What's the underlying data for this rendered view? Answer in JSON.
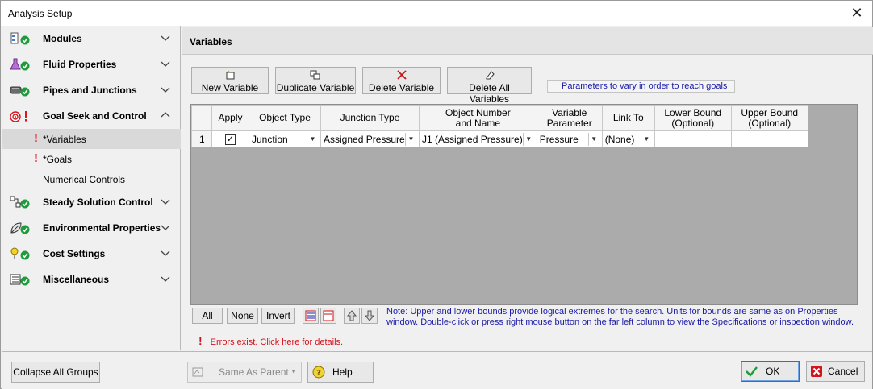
{
  "window": {
    "title": "Analysis Setup"
  },
  "nav": {
    "groups": [
      {
        "label": "Modules",
        "icon": "modules-icon"
      },
      {
        "label": "Fluid Properties",
        "icon": "flask-icon"
      },
      {
        "label": "Pipes and Junctions",
        "icon": "pipe-icon"
      },
      {
        "label": "Goal Seek and Control",
        "icon": "target-icon"
      },
      {
        "label": "Steady Solution Control",
        "icon": "solution-icon"
      },
      {
        "label": "Environmental Properties",
        "icon": "leaf-icon"
      },
      {
        "label": "Cost Settings",
        "icon": "coin-icon"
      },
      {
        "label": "Miscellaneous",
        "icon": "list-icon"
      }
    ],
    "subitems": [
      {
        "label": "*Variables",
        "error": "!"
      },
      {
        "label": "*Goals",
        "error": "!"
      },
      {
        "label": "Numerical Controls",
        "error": ""
      }
    ]
  },
  "panel": {
    "title": "Variables",
    "toolbar": {
      "new_variable": "New Variable",
      "duplicate_variable": "Duplicate Variable",
      "delete_variable": "Delete Variable",
      "delete_all_variables": "Delete All Variables"
    },
    "hint": "Parameters to vary in order to reach goals",
    "table": {
      "headers": {
        "apply": "Apply",
        "object_type": "Object Type",
        "junction_type": "Junction Type",
        "object_number_1": "Object Number",
        "object_number_2": "and Name",
        "variable_parameter_1": "Variable",
        "variable_parameter_2": "Parameter",
        "link_to": "Link To",
        "lower_bound_1": "Lower Bound",
        "lower_bound_2": "(Optional)",
        "upper_bound_1": "Upper Bound",
        "upper_bound_2": "(Optional)"
      },
      "rows": [
        {
          "row_number": "1",
          "apply": "✓",
          "object_type": "Junction",
          "junction_type": "Assigned Pressure",
          "object_number_and_name": "J1 (Assigned Pressure)",
          "variable_parameter": "Pressure",
          "link_to": "(None)",
          "lower_bound": "",
          "upper_bound": ""
        }
      ]
    },
    "select_buttons": {
      "all": "All",
      "none": "None",
      "invert": "Invert"
    },
    "note": "Note: Upper and lower bounds provide logical extremes for the search. Units for bounds are same as on Properties window. Double-click or press right mouse button on the far left column to view the Specifications or inspection window.",
    "errors": {
      "icon": "!",
      "text": "Errors exist. Click here for details."
    }
  },
  "footer": {
    "collapse_all_groups": "Collapse All Groups",
    "same_as_parent": "Same As Parent",
    "help": "Help",
    "ok": "OK",
    "cancel": "Cancel"
  },
  "colors": {
    "error_red": "#e0141e",
    "note_blue": "#1a1aa6",
    "check_green": "#1e9c3c",
    "grid_bg": "#ababab"
  }
}
